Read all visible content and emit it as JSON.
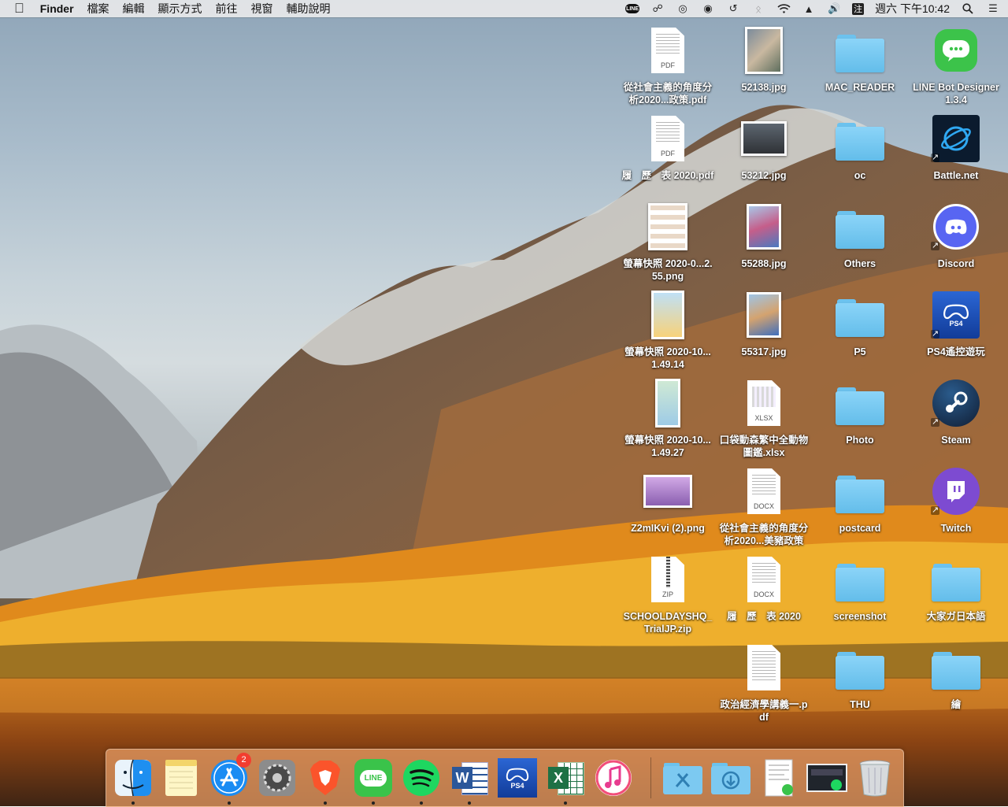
{
  "menubar": {
    "apple_icon": "apple-icon",
    "app_name": "Finder",
    "menus": [
      "檔案",
      "編輯",
      "顯示方式",
      "前往",
      "視窗",
      "輔助說明"
    ],
    "status": {
      "line_label": "LINE",
      "input_method": "注",
      "clock": "週六 下午10:42"
    }
  },
  "desktop": {
    "col1": [
      {
        "label": "從社會主義的角度分析2020...政策.pdf",
        "kind": "pdf",
        "tag": "PDF"
      },
      {
        "label": "履　歷　表 2020.pdf",
        "kind": "pdf",
        "tag": "PDF"
      },
      {
        "label": "螢幕快照 2020-0...2.55.png",
        "kind": "screenshot"
      },
      {
        "label": "螢幕快照 2020-10...1.49.14",
        "kind": "screenshot"
      },
      {
        "label": "螢幕快照 2020-10...1.49.27",
        "kind": "screenshot"
      },
      {
        "label": "Z2mIKvi (2).png",
        "kind": "image"
      },
      {
        "label": "SCHOOLDAYSHQ_ TrialJP.zip",
        "kind": "zip",
        "tag": "ZIP"
      }
    ],
    "col2": [
      {
        "label": "52138.jpg",
        "kind": "photo"
      },
      {
        "label": "53212.jpg",
        "kind": "photo"
      },
      {
        "label": "55288.jpg",
        "kind": "photo"
      },
      {
        "label": "55317.jpg",
        "kind": "photo"
      },
      {
        "label": "口袋動森繁中全動物圖鑑.xlsx",
        "kind": "xlsx",
        "tag": "XLSX"
      },
      {
        "label": "從社會主義的角度分析2020...美豬政策",
        "kind": "docx",
        "tag": "DOCX"
      },
      {
        "label": "履　歷　表 2020",
        "kind": "docx",
        "tag": "DOCX"
      },
      {
        "label": "政治經濟學講義一.pdf",
        "kind": "pdf",
        "tag": ""
      }
    ],
    "col3": [
      {
        "label": "MAC_READER"
      },
      {
        "label": "oc"
      },
      {
        "label": "Others"
      },
      {
        "label": "P5"
      },
      {
        "label": "Photo"
      },
      {
        "label": "postcard"
      },
      {
        "label": "screenshot"
      },
      {
        "label": "THU"
      }
    ],
    "col4": [
      {
        "label": "LINE Bot Designer 1.3.4",
        "kind": "app",
        "icon": "line-bot-designer-icon",
        "color": "#3cc34a"
      },
      {
        "label": "Battle.net",
        "kind": "app",
        "icon": "battlenet-icon",
        "color": "#0b1b2e"
      },
      {
        "label": "Discord",
        "kind": "app",
        "icon": "discord-icon",
        "color": "#5865f2"
      },
      {
        "label": "PS4遙控遊玩",
        "kind": "app",
        "icon": "ps4-remote-play-icon",
        "color": "#1f4fb4",
        "tag": "PS4"
      },
      {
        "label": "Steam",
        "kind": "app",
        "icon": "steam-icon",
        "color": "#16304f"
      },
      {
        "label": "Twitch",
        "kind": "app",
        "icon": "twitch-icon",
        "color": "#7d4bd1"
      },
      {
        "label": "大家ガ日本語",
        "kind": "folder"
      },
      {
        "label": "繪",
        "kind": "folder"
      }
    ]
  },
  "dock": {
    "items": [
      {
        "name": "finder-icon",
        "running": true
      },
      {
        "name": "notes-icon",
        "running": false
      },
      {
        "name": "app-store-icon",
        "running": true,
        "badge": "2"
      },
      {
        "name": "system-preferences-icon",
        "running": false
      },
      {
        "name": "brave-browser-icon",
        "running": true
      },
      {
        "name": "line-icon",
        "running": true,
        "text": "LINE"
      },
      {
        "name": "spotify-icon",
        "running": true
      },
      {
        "name": "word-icon",
        "running": true,
        "text": "W"
      },
      {
        "name": "ps4-remote-play-icon",
        "running": false,
        "text": "PS4"
      },
      {
        "name": "excel-icon",
        "running": true,
        "text": "X"
      },
      {
        "name": "itunes-icon",
        "running": false
      }
    ],
    "right_items": [
      {
        "name": "applications-folder-icon"
      },
      {
        "name": "downloads-folder-icon"
      },
      {
        "name": "document-stack-icon"
      },
      {
        "name": "screenshot-stack-icon"
      },
      {
        "name": "trash-icon"
      }
    ]
  },
  "colors": {
    "folder_blue": "#63bdea",
    "dock_tint": "#eca066",
    "badge_red": "#f33d2f"
  }
}
